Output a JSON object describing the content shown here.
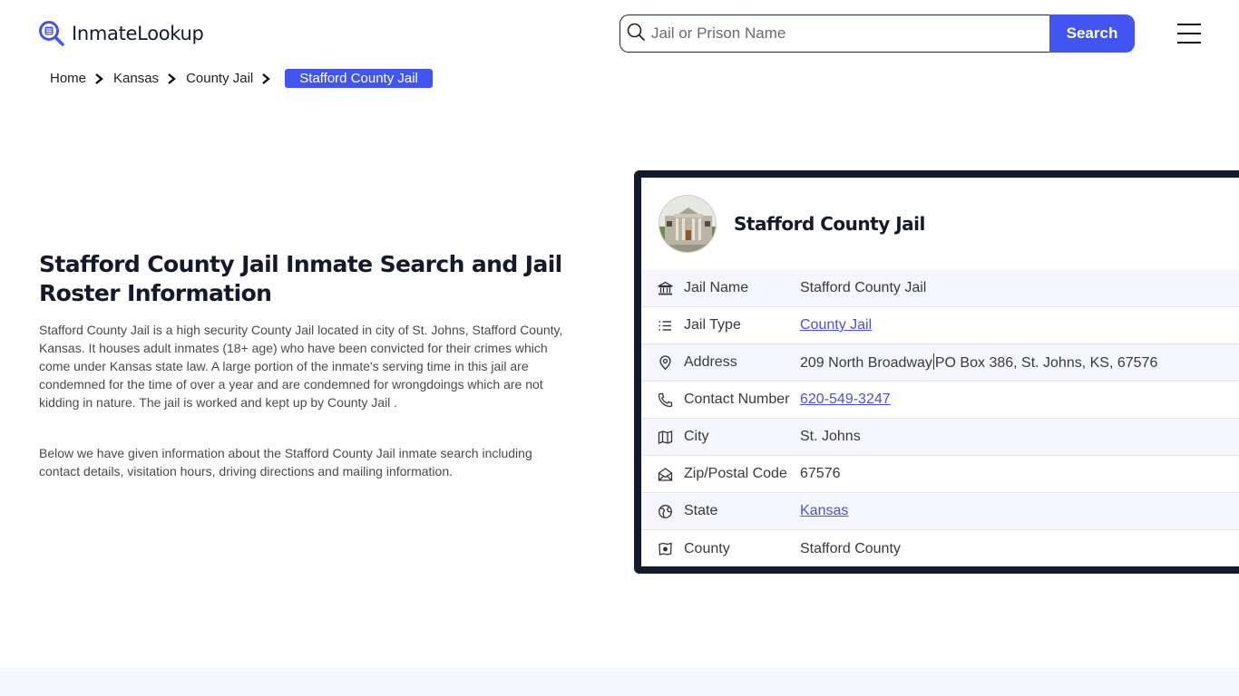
{
  "header": {
    "logo_text": "InmateLookup",
    "logo_icon": "magnifier-document-icon",
    "search": {
      "placeholder": "Jail or Prison Name",
      "value": "",
      "button_label": "Search"
    },
    "menu_icon": "hamburger-menu-icon"
  },
  "breadcrumb": {
    "items": [
      "Home",
      "Kansas",
      "County Jail"
    ],
    "active": "Stafford County Jail"
  },
  "main": {
    "title": "Stafford County Jail Inmate Search and Jail Roster Information",
    "paragraphs": [
      "Stafford County Jail is a high security County Jail located in city of St. Johns, Stafford County, Kansas. It houses adult inmates (18+ age) who have been convicted for their crimes which come under Kansas state law. A large portion of the inmate's serving time in this jail are condemned for the time of over a year and are condemned for wrongdoings which are not kidding in nature. The jail is worked and kept up by County Jail .",
      "Below we have given information about the Stafford County Jail inmate search including contact details, visitation hours, driving directions and mailing information."
    ]
  },
  "card": {
    "title": "Stafford County Jail",
    "image_alt": "courthouse-photo",
    "rows": [
      {
        "icon": "bank-building-icon",
        "label": "Jail Name",
        "value": "Stafford County Jail",
        "link": false
      },
      {
        "icon": "list-icon",
        "label": "Jail Type",
        "value": "County Jail",
        "link": true
      },
      {
        "icon": "map-pin-icon",
        "label": "Address",
        "value_part1": "209 North Broadway",
        "value_part2": "PO Box 386, St. Johns, KS, 67576",
        "link": false
      },
      {
        "icon": "phone-icon",
        "label": "Contact Number",
        "value": "620-549-3247",
        "link": true
      },
      {
        "icon": "map-icon",
        "label": "City",
        "value": "St. Johns",
        "link": false
      },
      {
        "icon": "mail-open-icon",
        "label": "Zip/Postal Code",
        "value": "67576",
        "link": false
      },
      {
        "icon": "globe-icon",
        "label": "State",
        "value": "Kansas",
        "link": true
      },
      {
        "icon": "county-map-icon",
        "label": "County",
        "value": "Stafford County",
        "link": false
      }
    ]
  },
  "colors": {
    "accent": "#4355f0",
    "dark": "#121a2e",
    "link": "#4a52d6",
    "row_alt": "#f5f6fc"
  }
}
